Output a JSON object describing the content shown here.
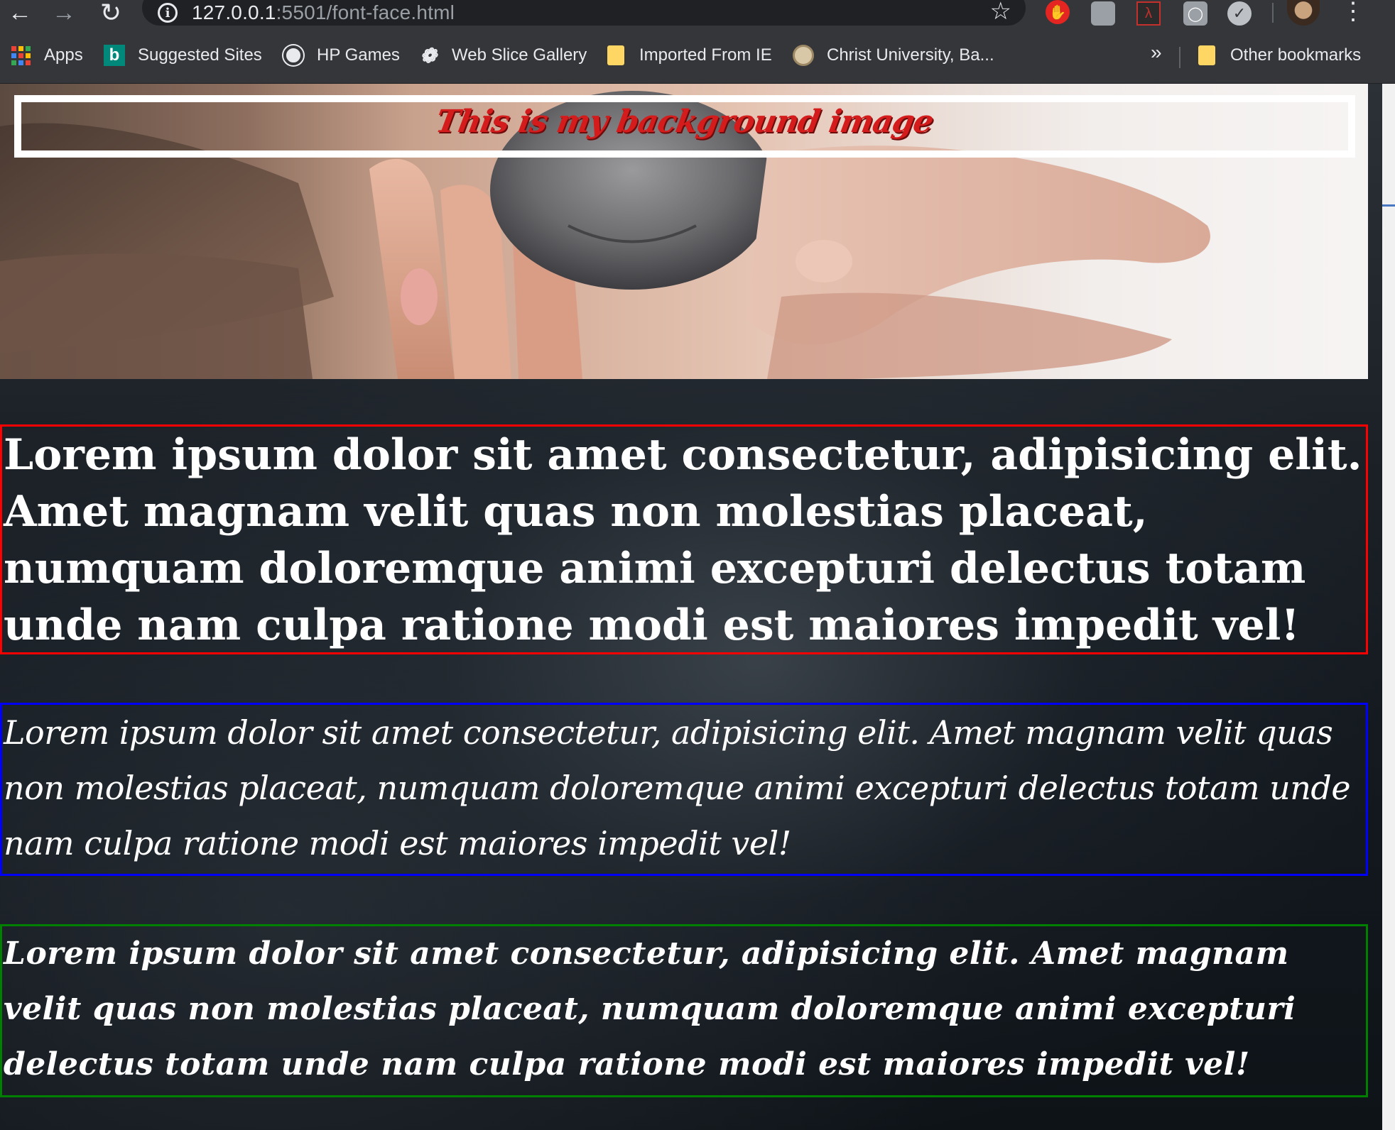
{
  "browser": {
    "url_host": "127.0.0.1",
    "url_rest": ":5501/font-face.html",
    "bookmarks": [
      {
        "label": "Apps"
      },
      {
        "label": "Suggested Sites"
      },
      {
        "label": "HP Games"
      },
      {
        "label": "Web Slice Gallery"
      },
      {
        "label": "Imported From IE"
      },
      {
        "label": "Christ University, Ba..."
      }
    ],
    "overflow": "»",
    "other_bookmarks": "Other bookmarks"
  },
  "page": {
    "banner": "This is my background image",
    "paragraphs": [
      "Lorem ipsum dolor sit amet consectetur, adipisicing elit. Amet magnam velit quas non molestias placeat, numquam doloremque animi excepturi delectus totam unde nam culpa ratione modi est maiores impedit vel!",
      "Lorem ipsum dolor sit amet consectetur, adipisicing elit. Amet magnam velit quas non molestias placeat, numquam doloremque animi excepturi delectus totam unde nam culpa ratione modi est maiores impedit vel!",
      "Lorem ipsum dolor sit amet consectetur, adipisicing elit. Amet magnam velit quas non molestias placeat, numquam doloremque animi excepturi delectus totam unde nam culpa ratione modi est maiores impedit vel!"
    ],
    "border_colors": [
      "#ff0000",
      "#0000ff",
      "#008000"
    ],
    "banner_color": "#d41c1c"
  },
  "icons": [
    "back-arrow-icon",
    "forward-arrow-icon",
    "reload-icon",
    "info-icon",
    "star-icon",
    "adblock-icon",
    "extension-icon",
    "pdf-icon",
    "bulb-icon",
    "ccleaner-icon",
    "avatar",
    "menu-icon",
    "apps-grid-icon",
    "bing-icon",
    "globe-icon",
    "web-slice-icon",
    "folder-icon",
    "university-seal-icon"
  ]
}
